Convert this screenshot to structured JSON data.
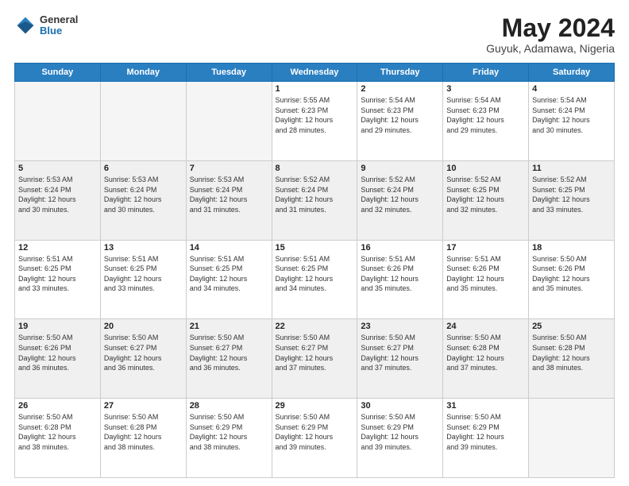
{
  "header": {
    "logo_general": "General",
    "logo_blue": "Blue",
    "title": "May 2024",
    "location": "Guyuk, Adamawa, Nigeria"
  },
  "days_of_week": [
    "Sunday",
    "Monday",
    "Tuesday",
    "Wednesday",
    "Thursday",
    "Friday",
    "Saturday"
  ],
  "weeks": [
    [
      {
        "day": "",
        "info": ""
      },
      {
        "day": "",
        "info": ""
      },
      {
        "day": "",
        "info": ""
      },
      {
        "day": "1",
        "info": "Sunrise: 5:55 AM\nSunset: 6:23 PM\nDaylight: 12 hours\nand 28 minutes."
      },
      {
        "day": "2",
        "info": "Sunrise: 5:54 AM\nSunset: 6:23 PM\nDaylight: 12 hours\nand 29 minutes."
      },
      {
        "day": "3",
        "info": "Sunrise: 5:54 AM\nSunset: 6:23 PM\nDaylight: 12 hours\nand 29 minutes."
      },
      {
        "day": "4",
        "info": "Sunrise: 5:54 AM\nSunset: 6:24 PM\nDaylight: 12 hours\nand 30 minutes."
      }
    ],
    [
      {
        "day": "5",
        "info": "Sunrise: 5:53 AM\nSunset: 6:24 PM\nDaylight: 12 hours\nand 30 minutes."
      },
      {
        "day": "6",
        "info": "Sunrise: 5:53 AM\nSunset: 6:24 PM\nDaylight: 12 hours\nand 30 minutes."
      },
      {
        "day": "7",
        "info": "Sunrise: 5:53 AM\nSunset: 6:24 PM\nDaylight: 12 hours\nand 31 minutes."
      },
      {
        "day": "8",
        "info": "Sunrise: 5:52 AM\nSunset: 6:24 PM\nDaylight: 12 hours\nand 31 minutes."
      },
      {
        "day": "9",
        "info": "Sunrise: 5:52 AM\nSunset: 6:24 PM\nDaylight: 12 hours\nand 32 minutes."
      },
      {
        "day": "10",
        "info": "Sunrise: 5:52 AM\nSunset: 6:25 PM\nDaylight: 12 hours\nand 32 minutes."
      },
      {
        "day": "11",
        "info": "Sunrise: 5:52 AM\nSunset: 6:25 PM\nDaylight: 12 hours\nand 33 minutes."
      }
    ],
    [
      {
        "day": "12",
        "info": "Sunrise: 5:51 AM\nSunset: 6:25 PM\nDaylight: 12 hours\nand 33 minutes."
      },
      {
        "day": "13",
        "info": "Sunrise: 5:51 AM\nSunset: 6:25 PM\nDaylight: 12 hours\nand 33 minutes."
      },
      {
        "day": "14",
        "info": "Sunrise: 5:51 AM\nSunset: 6:25 PM\nDaylight: 12 hours\nand 34 minutes."
      },
      {
        "day": "15",
        "info": "Sunrise: 5:51 AM\nSunset: 6:25 PM\nDaylight: 12 hours\nand 34 minutes."
      },
      {
        "day": "16",
        "info": "Sunrise: 5:51 AM\nSunset: 6:26 PM\nDaylight: 12 hours\nand 35 minutes."
      },
      {
        "day": "17",
        "info": "Sunrise: 5:51 AM\nSunset: 6:26 PM\nDaylight: 12 hours\nand 35 minutes."
      },
      {
        "day": "18",
        "info": "Sunrise: 5:50 AM\nSunset: 6:26 PM\nDaylight: 12 hours\nand 35 minutes."
      }
    ],
    [
      {
        "day": "19",
        "info": "Sunrise: 5:50 AM\nSunset: 6:26 PM\nDaylight: 12 hours\nand 36 minutes."
      },
      {
        "day": "20",
        "info": "Sunrise: 5:50 AM\nSunset: 6:27 PM\nDaylight: 12 hours\nand 36 minutes."
      },
      {
        "day": "21",
        "info": "Sunrise: 5:50 AM\nSunset: 6:27 PM\nDaylight: 12 hours\nand 36 minutes."
      },
      {
        "day": "22",
        "info": "Sunrise: 5:50 AM\nSunset: 6:27 PM\nDaylight: 12 hours\nand 37 minutes."
      },
      {
        "day": "23",
        "info": "Sunrise: 5:50 AM\nSunset: 6:27 PM\nDaylight: 12 hours\nand 37 minutes."
      },
      {
        "day": "24",
        "info": "Sunrise: 5:50 AM\nSunset: 6:28 PM\nDaylight: 12 hours\nand 37 minutes."
      },
      {
        "day": "25",
        "info": "Sunrise: 5:50 AM\nSunset: 6:28 PM\nDaylight: 12 hours\nand 38 minutes."
      }
    ],
    [
      {
        "day": "26",
        "info": "Sunrise: 5:50 AM\nSunset: 6:28 PM\nDaylight: 12 hours\nand 38 minutes."
      },
      {
        "day": "27",
        "info": "Sunrise: 5:50 AM\nSunset: 6:28 PM\nDaylight: 12 hours\nand 38 minutes."
      },
      {
        "day": "28",
        "info": "Sunrise: 5:50 AM\nSunset: 6:29 PM\nDaylight: 12 hours\nand 38 minutes."
      },
      {
        "day": "29",
        "info": "Sunrise: 5:50 AM\nSunset: 6:29 PM\nDaylight: 12 hours\nand 39 minutes."
      },
      {
        "day": "30",
        "info": "Sunrise: 5:50 AM\nSunset: 6:29 PM\nDaylight: 12 hours\nand 39 minutes."
      },
      {
        "day": "31",
        "info": "Sunrise: 5:50 AM\nSunset: 6:29 PM\nDaylight: 12 hours\nand 39 minutes."
      },
      {
        "day": "",
        "info": ""
      }
    ]
  ]
}
